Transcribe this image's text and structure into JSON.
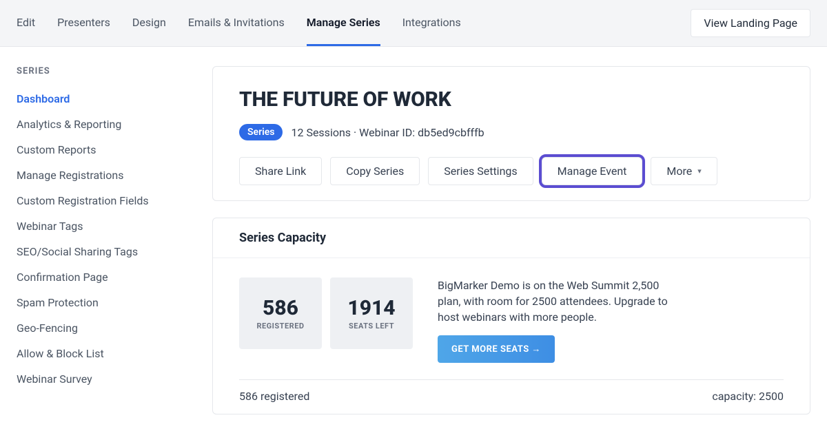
{
  "topbar": {
    "tabs": [
      {
        "label": "Edit"
      },
      {
        "label": "Presenters"
      },
      {
        "label": "Design"
      },
      {
        "label": "Emails & Invitations"
      },
      {
        "label": "Manage Series"
      },
      {
        "label": "Integrations"
      }
    ],
    "view_landing": "View Landing Page"
  },
  "sidebar": {
    "heading": "SERIES",
    "items": [
      {
        "label": "Dashboard"
      },
      {
        "label": "Analytics & Reporting"
      },
      {
        "label": "Custom Reports"
      },
      {
        "label": "Manage Registrations"
      },
      {
        "label": "Custom Registration Fields"
      },
      {
        "label": "Webinar Tags"
      },
      {
        "label": "SEO/Social Sharing Tags"
      },
      {
        "label": "Confirmation Page"
      },
      {
        "label": "Spam Protection"
      },
      {
        "label": "Geo-Fencing"
      },
      {
        "label": "Allow & Block List"
      },
      {
        "label": "Webinar Survey"
      }
    ]
  },
  "event": {
    "title": "THE FUTURE OF WORK",
    "badge": "Series",
    "meta": "12 Sessions · Webinar ID: db5ed9cbfffb",
    "actions": {
      "share": "Share Link",
      "copy": "Copy Series",
      "settings": "Series Settings",
      "manage": "Manage Event",
      "more": "More"
    }
  },
  "capacity": {
    "title": "Series Capacity",
    "registered_value": "586",
    "registered_label": "REGISTERED",
    "seats_value": "1914",
    "seats_label": "SEATS LEFT",
    "description": "BigMarker Demo is on the Web Summit 2,500 plan, with room for 2500 attendees. Upgrade to host webinars with more people.",
    "cta": "GET MORE SEATS →",
    "footer_left": "586 registered",
    "footer_right": "capacity: 2500"
  }
}
